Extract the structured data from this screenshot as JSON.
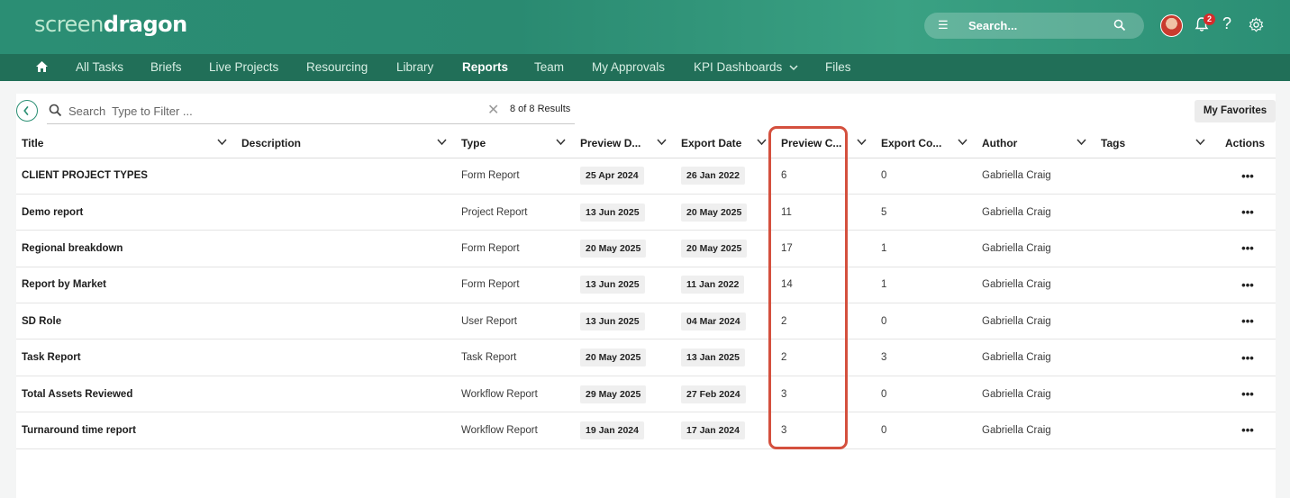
{
  "app": {
    "logo_part1": "screen",
    "logo_part2": "dragon",
    "search_label": "Search...",
    "notification_count": "2",
    "help_glyph": "?"
  },
  "nav": {
    "items": [
      {
        "label": "All Tasks"
      },
      {
        "label": "Briefs"
      },
      {
        "label": "Live Projects"
      },
      {
        "label": "Resourcing"
      },
      {
        "label": "Library"
      },
      {
        "label": "Reports",
        "active": true
      },
      {
        "label": "Team"
      },
      {
        "label": "My Approvals"
      },
      {
        "label": "KPI Dashboards"
      },
      {
        "label": "Files"
      }
    ]
  },
  "toolbar": {
    "filter_placeholder": "Search  Type to Filter ...",
    "results": "8 of 8 Results",
    "favorites": "My Favorites"
  },
  "table": {
    "columns": [
      "Title",
      "Description",
      "Type",
      "Preview D...",
      "Export Date",
      "Preview C...",
      "Export Co...",
      "Author",
      "Tags",
      "Actions"
    ],
    "rows": [
      {
        "title": "CLIENT PROJECT TYPES",
        "description": "",
        "type": "Form Report",
        "preview_date": "25 Apr 2024",
        "export_date": "26 Jan 2022",
        "preview_count": "6",
        "export_count": "0",
        "author": "Gabriella Craig",
        "tags": "",
        "actions": "•••"
      },
      {
        "title": "Demo report",
        "description": "",
        "type": "Project Report",
        "preview_date": "13 Jun 2025",
        "export_date": "20 May 2025",
        "preview_count": "11",
        "export_count": "5",
        "author": "Gabriella Craig",
        "tags": "",
        "actions": "•••"
      },
      {
        "title": "Regional breakdown",
        "description": "",
        "type": "Form Report",
        "preview_date": "20 May 2025",
        "export_date": "20 May 2025",
        "preview_count": "17",
        "export_count": "1",
        "author": "Gabriella Craig",
        "tags": "",
        "actions": "•••"
      },
      {
        "title": "Report by Market",
        "description": "",
        "type": "Form Report",
        "preview_date": "13 Jun 2025",
        "export_date": "11 Jan 2022",
        "preview_count": "14",
        "export_count": "1",
        "author": "Gabriella Craig",
        "tags": "",
        "actions": "•••"
      },
      {
        "title": "SD Role",
        "description": "",
        "type": "User Report",
        "preview_date": "13 Jun 2025",
        "export_date": "04 Mar 2024",
        "preview_count": "2",
        "export_count": "0",
        "author": "Gabriella Craig",
        "tags": "",
        "actions": "•••"
      },
      {
        "title": "Task Report",
        "description": "",
        "type": "Task Report",
        "preview_date": "20 May 2025",
        "export_date": "13 Jan 2025",
        "preview_count": "2",
        "export_count": "3",
        "author": "Gabriella Craig",
        "tags": "",
        "actions": "•••"
      },
      {
        "title": "Total Assets Reviewed",
        "description": "",
        "type": "Workflow Report",
        "preview_date": "29 May 2025",
        "export_date": "27 Feb 2024",
        "preview_count": "3",
        "export_count": "0",
        "author": "Gabriella Craig",
        "tags": "",
        "actions": "•••"
      },
      {
        "title": "Turnaround time report",
        "description": "",
        "type": "Workflow Report",
        "preview_date": "19 Jan 2024",
        "export_date": "17 Jan 2024",
        "preview_count": "3",
        "export_count": "0",
        "author": "Gabriella Craig",
        "tags": "",
        "actions": "•••"
      }
    ]
  },
  "colors": {
    "brand_green": "#2b8e74",
    "nav_green": "#216f58",
    "highlight_red": "#d4503e"
  },
  "icons": {
    "home": "home-icon",
    "menu": "menu-icon",
    "search": "search-icon",
    "bell": "bell-icon",
    "help": "help-icon",
    "settings": "gear-icon",
    "back": "back-arrow-icon",
    "clear": "close-icon",
    "column_menu": "chevron-down-icon",
    "actions": "more-horizontal-icon"
  }
}
